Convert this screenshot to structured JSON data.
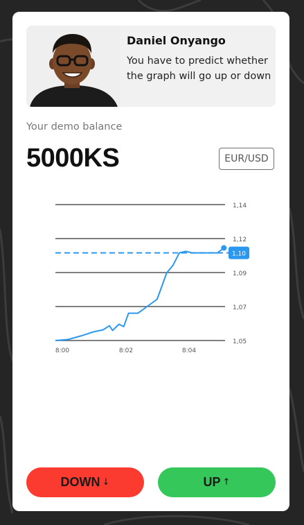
{
  "profile": {
    "name": "Daniel Onyango",
    "message": "You have to predict whether the graph will go up or down"
  },
  "balance": {
    "label": "Your demo balance",
    "value": "5000KS"
  },
  "currency_pair": "EUR/USD",
  "chart_data": {
    "type": "line",
    "y_ticks": [
      "1,14",
      "1,12",
      "1,09",
      "1,07",
      "1,05"
    ],
    "x_ticks": [
      "8:00",
      "8:02",
      "8:04"
    ],
    "current_label": "1,10",
    "line_color": "#2b98f0",
    "series": [
      {
        "x": [
          0,
          0.4,
          0.8,
          1.2,
          1.5,
          1.7,
          1.8,
          2.0,
          2.15,
          2.3,
          2.6,
          2.9,
          3.2,
          3.5,
          3.7,
          3.9,
          4.1,
          4.3,
          4.5,
          4.7,
          4.9,
          5.1,
          5.3
        ],
        "y": [
          1.05,
          1.0506,
          1.0527,
          1.0551,
          1.0563,
          1.0587,
          1.0559,
          1.0596,
          1.0582,
          1.0661,
          1.0661,
          1.0702,
          1.0743,
          1.0898,
          1.0943,
          1.1016,
          1.1025,
          1.1016,
          1.1016,
          1.1016,
          1.1016,
          1.1016,
          1.1045
        ]
      }
    ],
    "current_value": 1.1016
  },
  "buttons": {
    "down_label": "DOWN",
    "down_arrow": "↓",
    "up_label": "UP",
    "up_arrow": "↑"
  },
  "colors": {
    "background": "#252525",
    "down": "#fb3b30",
    "up": "#35c759",
    "accent": "#2b98f0"
  }
}
